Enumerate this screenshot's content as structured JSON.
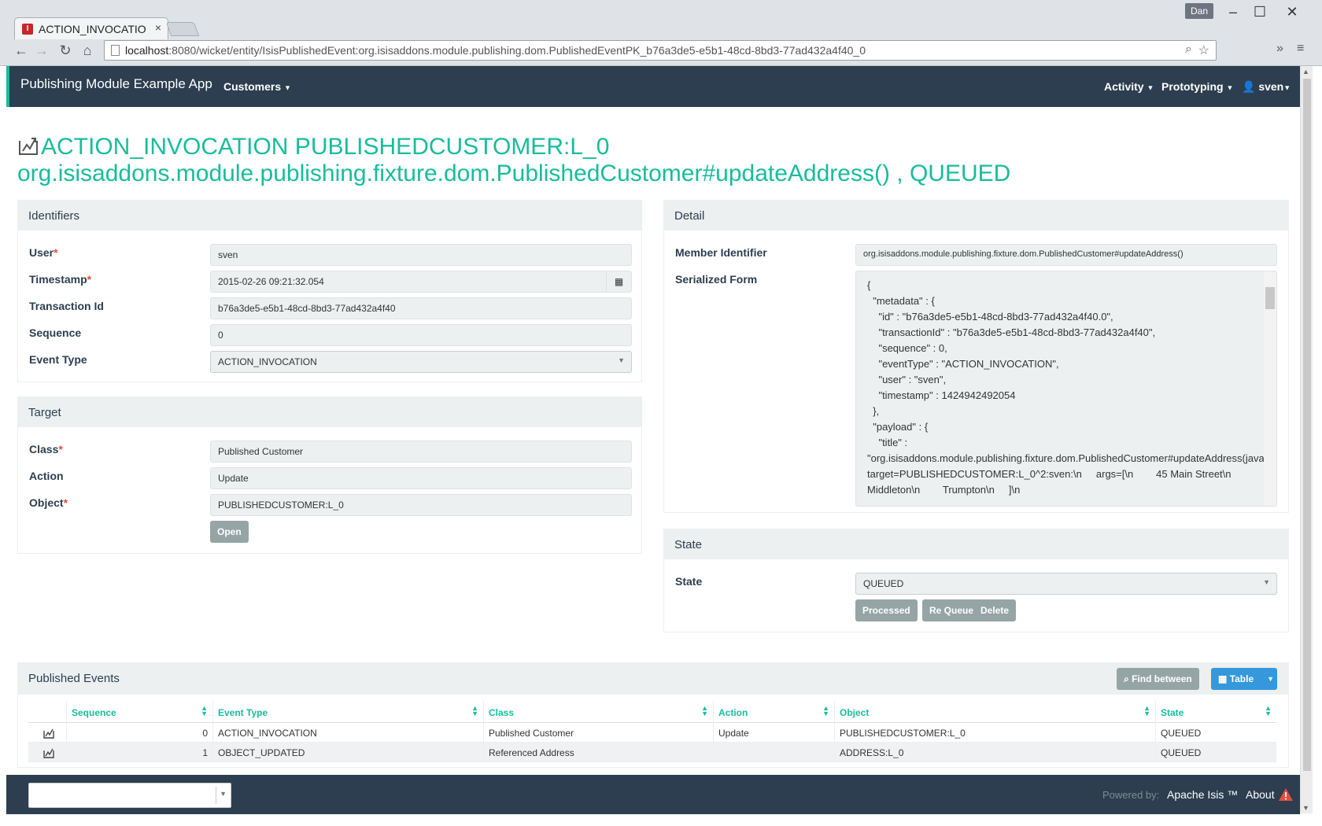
{
  "browser": {
    "tab_title": "ACTION_INVOCATIO",
    "user_chip": "Dan",
    "url_host": "localhost",
    "url_rest": ":8080/wicket/entity/IsisPublishedEvent:org.isisaddons.module.publishing.dom.PublishedEventPK_b76a3de5-e5b1-48cd-8bd3-77ad432a4f40_0"
  },
  "navbar": {
    "brand": "Publishing Module Example App",
    "customers": "Customers",
    "activity": "Activity",
    "prototyping": "Prototyping",
    "user": "sven"
  },
  "page": {
    "title_line1": "ACTION_INVOCATION PUBLISHEDCUSTOMER:L_0",
    "title_line2": "org.isisaddons.module.publishing.fixture.dom.PublishedCustomer#updateAddress() , QUEUED"
  },
  "identifiers": {
    "heading": "Identifiers",
    "user_label": "User",
    "user_value": "sven",
    "timestamp_label": "Timestamp",
    "timestamp_value": "2015-02-26 09:21:32.054",
    "transaction_label": "Transaction Id",
    "transaction_value": "b76a3de5-e5b1-48cd-8bd3-77ad432a4f40",
    "sequence_label": "Sequence",
    "sequence_value": "0",
    "eventtype_label": "Event Type",
    "eventtype_value": "ACTION_INVOCATION"
  },
  "target": {
    "heading": "Target",
    "class_label": "Class",
    "class_value": "Published Customer",
    "action_label": "Action",
    "action_value": "Update",
    "object_label": "Object",
    "object_value": "PUBLISHEDCUSTOMER:L_0",
    "open_button": "Open"
  },
  "detail": {
    "heading": "Detail",
    "member_label": "Member Identifier",
    "member_value": "org.isisaddons.module.publishing.fixture.dom.PublishedCustomer#updateAddress()",
    "serialized_label": "Serialized Form",
    "serialized_value": "{\n  \"metadata\" : {\n    \"id\" : \"b76a3de5-e5b1-48cd-8bd3-77ad432a4f40.0\",\n    \"transactionId\" : \"b76a3de5-e5b1-48cd-8bd3-77ad432a4f40\",\n    \"sequence\" : 0,\n    \"eventType\" : \"ACTION_INVOCATION\",\n    \"user\" : \"sven\",\n    \"timestamp\" : 1424942492054\n  },\n  \"payload\" : {\n    \"title\" :\n\"org.isisaddons.module.publishing.fixture.dom.PublishedCustomer#updateAddress(java.lang.String,java.lang.String,java.lang.String)\\n target=PUBLISHEDCUSTOMER:L_0^2:sven:\\n     args=[\\n        45 Main Street\\n Middleton\\n        Trumpton\\n     ]\\n"
  },
  "state": {
    "heading": "State",
    "state_label": "State",
    "state_value": "QUEUED",
    "processed_button": "Processed",
    "requeue_button": "Re Queue",
    "delete_button": "Delete"
  },
  "events": {
    "heading": "Published Events",
    "find_button": "Find between",
    "table_button": "Table",
    "columns": [
      "Sequence",
      "Event Type",
      "Class",
      "Action",
      "Object",
      "State"
    ],
    "rows": [
      {
        "sequence": "0",
        "event_type": "ACTION_INVOCATION",
        "class": "Published Customer",
        "action": "Update",
        "object": "PUBLISHEDCUSTOMER:L_0",
        "state": "QUEUED"
      },
      {
        "sequence": "1",
        "event_type": "OBJECT_UPDATED",
        "class": "Referenced Address",
        "action": "",
        "object": "ADDRESS:L_0",
        "state": "QUEUED"
      }
    ]
  },
  "footer": {
    "powered_by": "Powered by:",
    "framework": "Apache Isis ™",
    "about": "About"
  },
  "colors": {
    "accent": "#18bc9c",
    "navbar": "#2c3e50",
    "button_gray": "#95a5a6",
    "button_blue": "#3498db",
    "warning": "#e74c3c"
  }
}
